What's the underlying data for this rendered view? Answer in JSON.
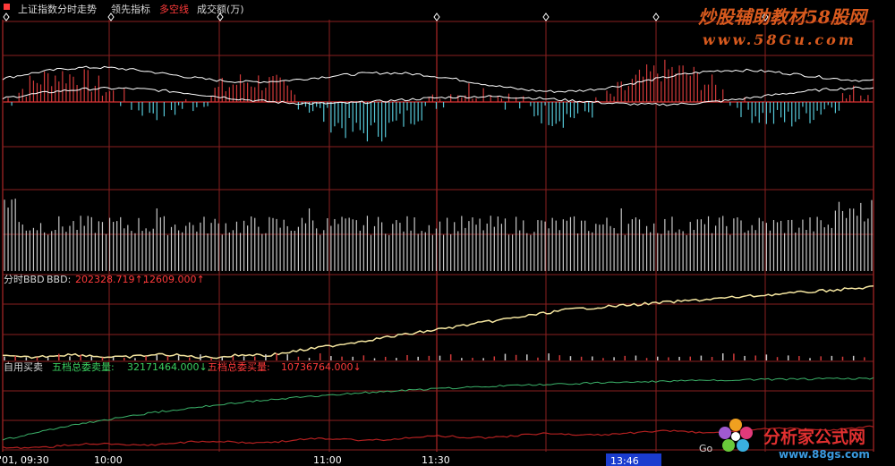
{
  "header": {
    "panel_title": "上证指数分时走势",
    "indicator_1": "领先指标",
    "indicator_2": "多空线",
    "indicator_3": "成交额(万)"
  },
  "bbd_panel": {
    "label": "分时BBD",
    "bbd_label": "BBD:",
    "value_1": "202328.719↑,",
    "value_2": "12609.000↑"
  },
  "orders_panel": {
    "label": "自用买卖",
    "sell_label": "五档总委卖量:",
    "sell_value": "32171464.000↓,",
    "buy_label": "五档总委买量:",
    "buy_value": "10736764.000↓"
  },
  "time_axis": {
    "t0": "'01, 09:30",
    "t1": "10:00",
    "t2": "11:00",
    "t3": "11:30",
    "t4": "13:46"
  },
  "watermarks": {
    "top_brand": "炒股辅助教材",
    "top_brand_num": "58股网",
    "top_url": "www.58Gu.com",
    "bottom_brand": "分析家公式网",
    "bottom_url": "www.88gs.com",
    "bottom_prefix": "Go"
  },
  "colors": {
    "grid": "#8a1f1f",
    "up": "#d23a3a",
    "down": "#56c8d8",
    "white_line": "#ffffff",
    "bbd_line": "#f5e6a0",
    "sell_line": "#3bb36a",
    "buy_line": "#b32020",
    "volume": "#c8c8c8",
    "header_red": "#ff3a3a",
    "header_text": "#d8d8d8",
    "green_text": "#3bd060",
    "time_highlight_bg": "#1a3ccf"
  },
  "icons": [
    "diamond-marker-icon"
  ]
}
